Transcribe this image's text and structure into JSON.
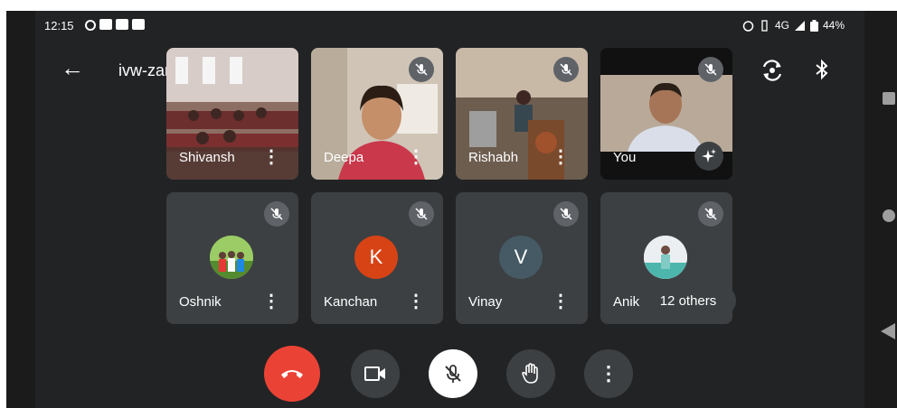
{
  "status_bar": {
    "time": "12:15",
    "network": "4G",
    "battery": "44%",
    "icons": [
      "alarm-icon",
      "vibrate-icon",
      "signal-icon",
      "battery-icon"
    ]
  },
  "meeting": {
    "code": "ivw-zarf-zrm",
    "code_caret": "▸"
  },
  "top_actions": {
    "switch_camera_icon": "flip-camera-icon",
    "bluetooth_icon": "bluetooth-icon"
  },
  "participants": [
    {
      "name": "Shivansh",
      "muted": false,
      "speaking": true
    },
    {
      "name": "Deepa",
      "muted": true
    },
    {
      "name": "Rishabh",
      "muted": true
    },
    {
      "name": "You",
      "muted": true,
      "effects_icon": "sparkle-icon"
    },
    {
      "name": "Oshnik",
      "muted": true,
      "avatar": "photo"
    },
    {
      "name": "Kanchan",
      "muted": true,
      "avatar": "K",
      "avatar_color": "#d84315"
    },
    {
      "name": "Vinay",
      "muted": true,
      "avatar": "V",
      "avatar_color": "#455a64"
    },
    {
      "name": "Anik",
      "muted": true,
      "avatar": "photo"
    }
  ],
  "others_badge": "12 others",
  "controls": [
    {
      "name": "end-call",
      "icon": "phone-hangup-icon",
      "color": "#ea4335"
    },
    {
      "name": "camera",
      "icon": "video-camera-icon"
    },
    {
      "name": "microphone",
      "icon": "mic-off-icon",
      "color": "#ffffff"
    },
    {
      "name": "raise-hand",
      "icon": "hand-icon"
    },
    {
      "name": "more",
      "icon": "more-vert-icon"
    }
  ],
  "more_glyph": "⋮"
}
